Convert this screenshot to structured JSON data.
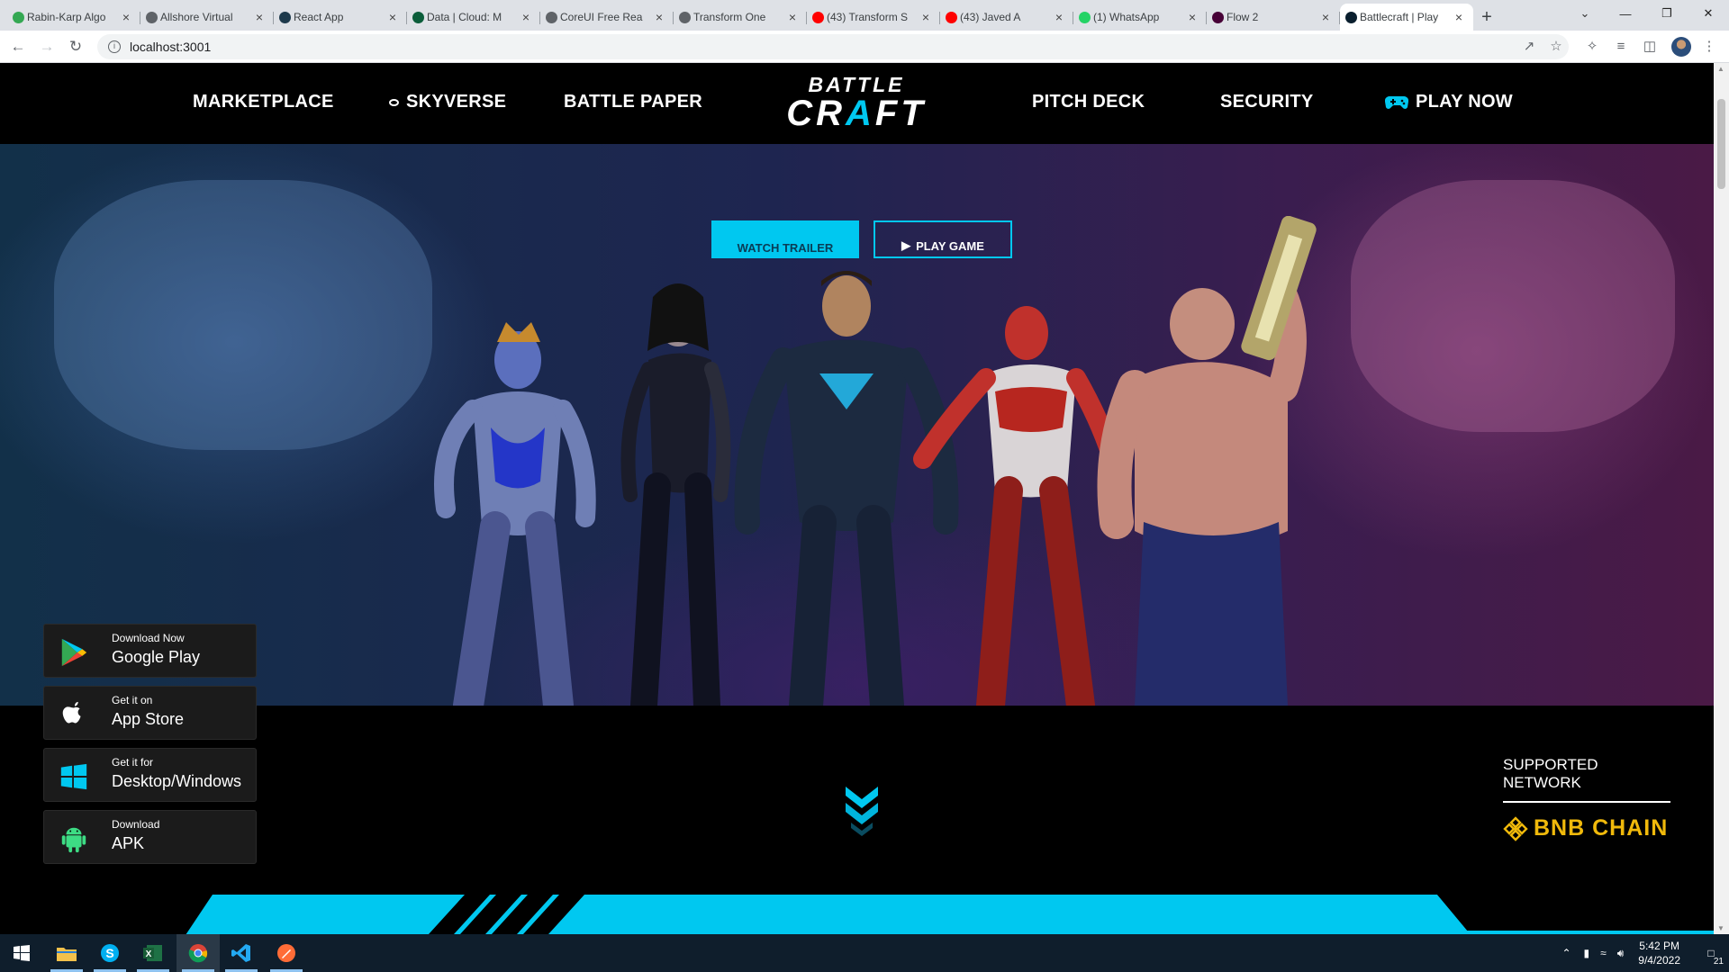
{
  "browser": {
    "tabs": [
      {
        "title": "Rabin-Karp Algo",
        "color": "#34a853"
      },
      {
        "title": "Allshore Virtual",
        "color": "#5f6368"
      },
      {
        "title": "React App",
        "color": "#1e3a4c"
      },
      {
        "title": "Data | Cloud: M",
        "color": "#0b5d3a"
      },
      {
        "title": "CoreUI Free Rea",
        "color": "#5f6368"
      },
      {
        "title": "Transform One",
        "color": "#5f6368"
      },
      {
        "title": "(43) Transform S",
        "color": "#ff0000"
      },
      {
        "title": "(43) Javed A",
        "color": "#ff0000"
      },
      {
        "title": "(1) WhatsApp",
        "color": "#25d366"
      },
      {
        "title": "Flow 2",
        "color": "#470137"
      },
      {
        "title": "Battlecraft | Play",
        "color": "#0a1f2e"
      }
    ],
    "url": "localhost:3001"
  },
  "nav": {
    "marketplace": "MARKETPLACE",
    "skyverse": "SKYVERSE",
    "battle_paper": "BATTLE PAPER",
    "logo_top": "BATTLE",
    "logo_bottom_1": "CR",
    "logo_bottom_a": "A",
    "logo_bottom_2": "FT",
    "pitch_deck": "PITCH DECK",
    "security": "SECURITY",
    "play_now": "PLAY NOW"
  },
  "hero": {
    "trailer_label": "WATCH TRAILER",
    "play_label": "PLAY GAME"
  },
  "stores": [
    {
      "small": "Download Now",
      "big": "Google Play",
      "icon": "google-play-icon"
    },
    {
      "small": "Get it on",
      "big": "App Store",
      "icon": "apple-icon"
    },
    {
      "small": "Get it for",
      "big": "Desktop/Windows",
      "icon": "windows-icon"
    },
    {
      "small": "Download",
      "big": "APK",
      "icon": "android-icon"
    }
  ],
  "network": {
    "label": "SUPPORTED NETWORK",
    "chain": "BNB CHAIN"
  },
  "taskbar": {
    "time": "5:42 PM",
    "date": "9/4/2022",
    "notifications": "21"
  },
  "colors": {
    "accent": "#00c8f0",
    "bnb": "#f0b90b",
    "navbar": "#000000"
  }
}
